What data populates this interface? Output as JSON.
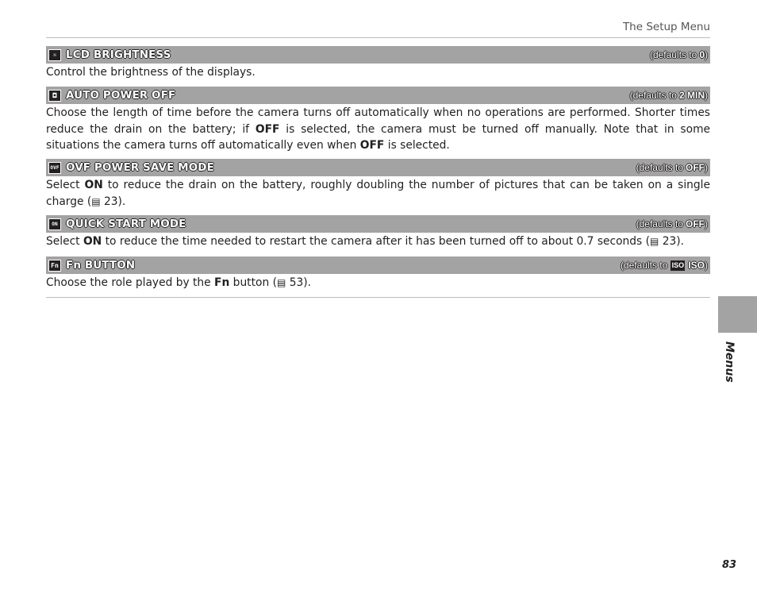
{
  "running_head": "The Setup Menu",
  "sections": [
    {
      "icon": "brightness-icon",
      "icon_glyph": "☼",
      "title": "LCD BRIGHTNESS",
      "default_prefix": "defaults to",
      "default_value": "0",
      "description": "Control the brightness of the displays."
    },
    {
      "icon": "auto-power-off-icon",
      "icon_glyph": "◘",
      "title": "AUTO POWER OFF",
      "default_prefix": "defaults to",
      "default_value": "2 MIN",
      "description_parts": [
        "Choose the length of time before the camera turns off automatically when no operations are performed.  Shorter times reduce the drain on the battery; if ",
        "OFF",
        " is selected, the camera must be turned off manually.  Note that in some situations the camera turns off automatically even when ",
        "OFF",
        " is selected."
      ]
    },
    {
      "icon": "ovf-icon",
      "icon_glyph": "OVF",
      "title": "OVF POWER SAVE MODE",
      "default_prefix": "defaults to",
      "default_value": "OFF",
      "description_parts": [
        "Select ",
        "ON",
        " to reduce the drain on the battery, roughly doubling the number of pictures that can be taken on a single charge (",
        "📖",
        " 23)."
      ]
    },
    {
      "icon": "quick-start-icon",
      "icon_glyph": "ON",
      "title": "QUICK START MODE",
      "default_prefix": "defaults to",
      "default_value": "OFF",
      "description_parts": [
        "Select ",
        "ON",
        " to reduce the time needed to restart the camera after it has been turned off to about 0.7 seconds (",
        "📖",
        " 23)."
      ]
    },
    {
      "icon": "fn-icon",
      "icon_glyph": "Fn",
      "title": "Fn BUTTON",
      "default_prefix": "defaults to",
      "default_icon": "ISO",
      "default_value": "ISO",
      "description_parts": [
        "Choose the role played by the ",
        "Fn",
        " button (",
        "📖",
        " 53)."
      ]
    }
  ],
  "side_tab": "Menus",
  "page_number": "83"
}
